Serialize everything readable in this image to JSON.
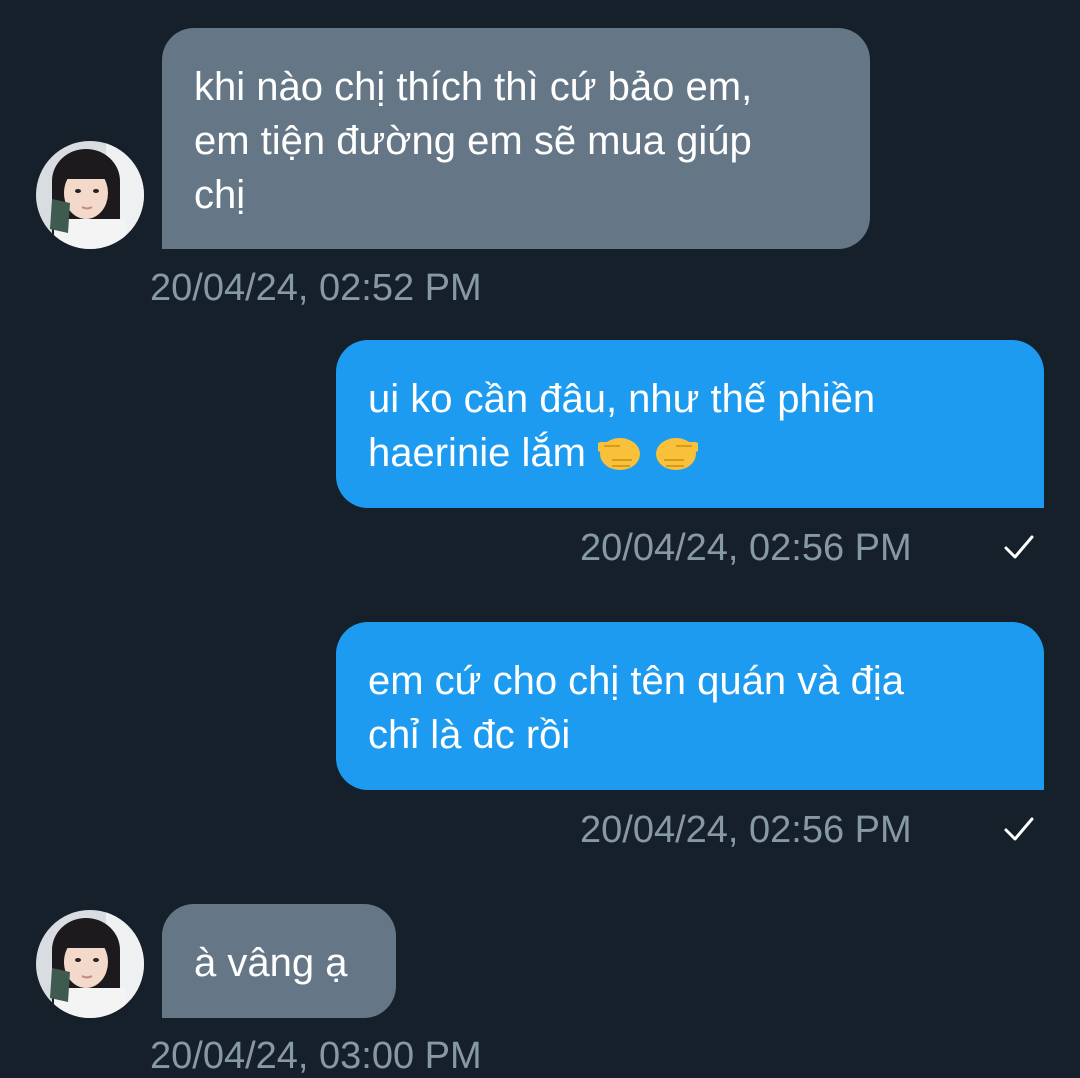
{
  "conversation": {
    "messages": [
      {
        "direction": "incoming",
        "lines": [
          "khi nào chị thích thì cứ bảo em,",
          "em tiện đường em sẽ mua giúp",
          "chị"
        ],
        "timestamp": "20/04/24, 02:52 PM"
      },
      {
        "direction": "outgoing",
        "lines": [
          "ui ko cần đâu, như thế phiền",
          "haerinie lắm"
        ],
        "emoji": "pointing-fingers-icon",
        "timestamp": "20/04/24, 02:56 PM",
        "status": "sent"
      },
      {
        "direction": "outgoing",
        "lines": [
          "em cứ cho chị tên quán và địa",
          "chỉ là đc rồi"
        ],
        "timestamp": "20/04/24, 02:56 PM",
        "status": "sent"
      },
      {
        "direction": "incoming",
        "lines": [
          "à vâng ạ"
        ],
        "timestamp": "20/04/24, 03:00 PM"
      }
    ]
  },
  "colors": {
    "background": "#15202b",
    "incoming_bubble": "#657786",
    "outgoing_bubble": "#1d9bf0",
    "timestamp_text": "#8899a6",
    "message_text": "#ffffff"
  }
}
